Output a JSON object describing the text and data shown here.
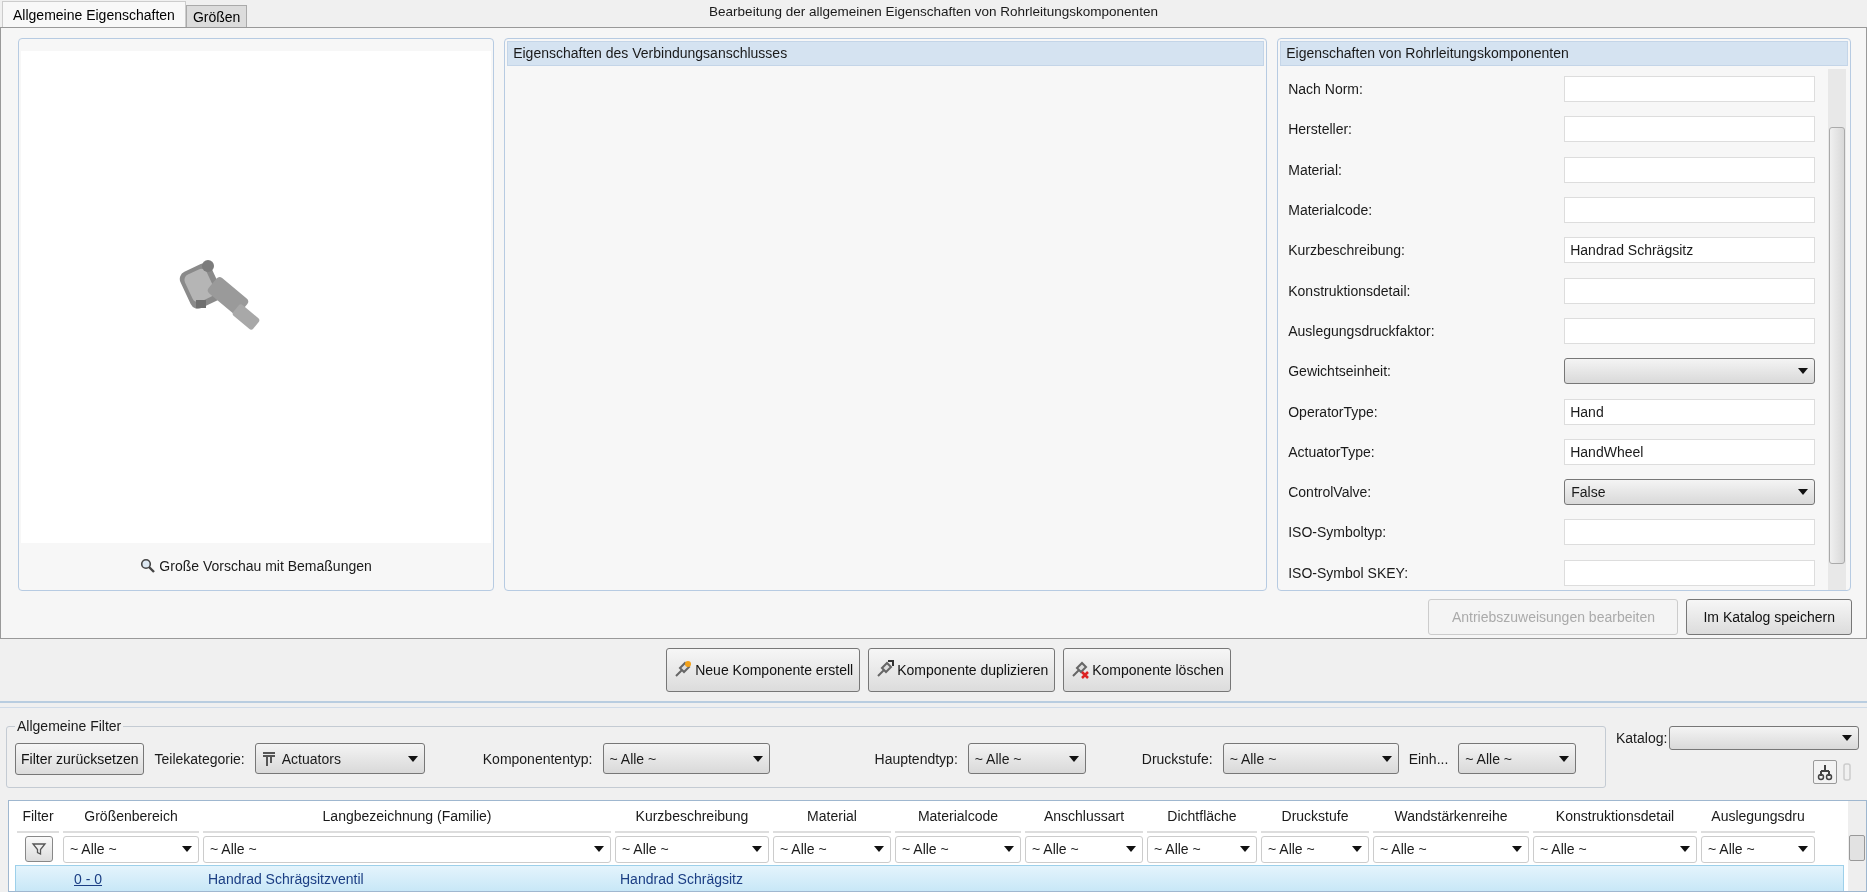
{
  "tabs": [
    {
      "label": "Allgemeine Eigenschaften",
      "selected": true
    },
    {
      "label": "Größen",
      "selected": false
    }
  ],
  "header_title": "Bearbeitung der allgemeinen Eigenschaften von Rohrleitungskomponenten",
  "preview": {
    "caption": "Große Vorschau mit Bemaßungen"
  },
  "connection_panel": {
    "title": "Eigenschaften des Verbindungsanschlusses"
  },
  "properties": {
    "title": "Eigenschaften von Rohrleitungskomponenten",
    "fields": [
      {
        "label": "Nach Norm:",
        "kind": "text"
      },
      {
        "label": "Hersteller:",
        "kind": "text"
      },
      {
        "label": "Material:",
        "kind": "text"
      },
      {
        "label": "Materialcode:",
        "kind": "text"
      },
      {
        "label": "Kurzbeschreibung:",
        "kind": "text",
        "value": "Handrad Schrägsitz"
      },
      {
        "label": "Konstruktionsdetail:",
        "kind": "text"
      },
      {
        "label": "Auslegungsdruckfaktor:",
        "kind": "text"
      },
      {
        "label": "Gewichtseinheit:",
        "kind": "dropdown"
      },
      {
        "label": "OperatorType:",
        "kind": "text",
        "value": "Hand"
      },
      {
        "label": "ActuatorType:",
        "kind": "text",
        "value": "HandWheel"
      },
      {
        "label": "ControlValve:",
        "kind": "dropdown",
        "value": "False"
      },
      {
        "label": "ISO-Symboltyp:",
        "kind": "text"
      },
      {
        "label": "ISO-Symbol SKEY:",
        "kind": "text"
      }
    ]
  },
  "property_buttons": [
    {
      "label": "Antriebszuweisungen bearbeiten",
      "disabled": true
    },
    {
      "label": "Im Katalog speichern",
      "disabled": false
    }
  ],
  "actions": [
    {
      "label": "Neue Komponente erstell",
      "kind": "new"
    },
    {
      "label": "Komponente duplizieren",
      "kind": "duplicate"
    },
    {
      "label": "Komponente löschen",
      "kind": "delete"
    }
  ],
  "filters": {
    "title": "Allgemeine Filter",
    "reset_button": "Filter zurücksetzen",
    "items": [
      {
        "label": "Teilekategorie:",
        "value": "Actuators",
        "kind": "category"
      },
      {
        "label": "Komponententyp:",
        "value": "~ Alle ~",
        "kind": "plain"
      },
      {
        "label": "Hauptendtyp:",
        "value": "~ Alle ~",
        "kind": "plain"
      },
      {
        "label": "Druckstufe:",
        "value": "~ Alle ~",
        "kind": "plain"
      },
      {
        "label": "Einh...",
        "value": "~ Alle ~",
        "kind": "plain"
      }
    ]
  },
  "catalog": {
    "label": "Katalog:"
  },
  "grid": {
    "columns": [
      {
        "label": "Filter",
        "kind": "funnel"
      },
      {
        "label": "Größenbereich",
        "filter": "~ Alle ~"
      },
      {
        "label": "Langbezeichnung (Familie)",
        "filter": "~ Alle ~"
      },
      {
        "label": "Kurzbeschreibung",
        "filter": "~ Alle ~"
      },
      {
        "label": "Material",
        "filter": "~ Alle ~"
      },
      {
        "label": "Materialcode",
        "filter": "~ Alle ~"
      },
      {
        "label": "Anschlussart",
        "filter": "~ Alle ~"
      },
      {
        "label": "Dichtfläche",
        "filter": "~ Alle ~"
      },
      {
        "label": "Druckstufe",
        "filter": "~ Alle ~"
      },
      {
        "label": "Wandstärkenreihe",
        "filter": "~ Alle ~"
      },
      {
        "label": "Konstruktionsdetail",
        "filter": "~ Alle ~"
      },
      {
        "label": "Auslegungsdru",
        "filter": "~ Alle ~"
      }
    ],
    "rows": [
      {
        "size_range": "0 - 0",
        "long_name": "Handrad Schrägsitzventil",
        "short_description": "Handrad Schrägsitz",
        "selected": true
      }
    ]
  }
}
